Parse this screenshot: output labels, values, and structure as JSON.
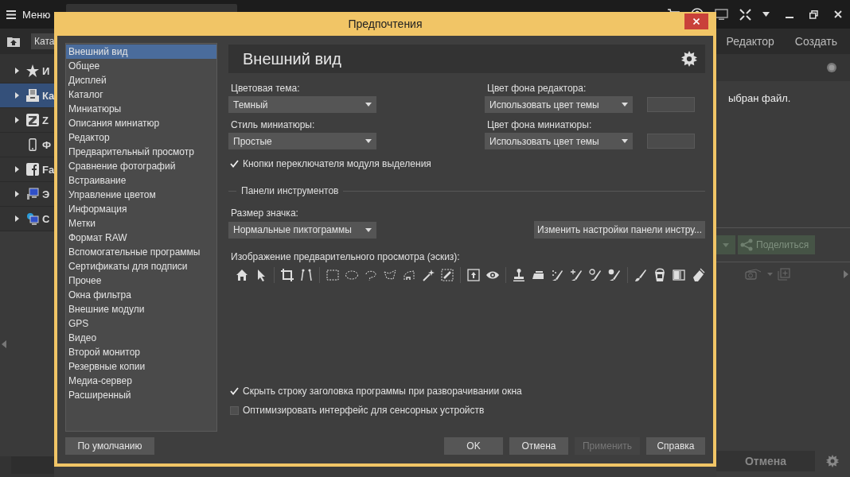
{
  "app": {
    "menu_label": "Меню",
    "breadcrumb": "Ката",
    "tabs": [
      {
        "label": "Редактор"
      },
      {
        "label": "Создать"
      }
    ],
    "nav_items": [
      {
        "label": "И",
        "kind": "star",
        "expandable": true,
        "selected": false
      },
      {
        "label": "Ка",
        "kind": "catalog",
        "expandable": true,
        "selected": true
      },
      {
        "label": "Z",
        "kind": "zletter",
        "expandable": true,
        "selected": false
      },
      {
        "label": "Ф",
        "kind": "phone",
        "expandable": false,
        "selected": false
      },
      {
        "label": "Fa",
        "kind": "facebook",
        "expandable": true,
        "selected": false
      },
      {
        "label": "Э",
        "kind": "computer",
        "expandable": true,
        "selected": false
      },
      {
        "label": "C",
        "kind": "network",
        "expandable": true,
        "selected": false
      }
    ],
    "info_text": "ыбран файл.",
    "share_button": "Поделиться",
    "cancel_button": "Отмена"
  },
  "dialog": {
    "title": "Предпочтения",
    "categories": [
      {
        "label": "Внешний вид",
        "selected": true
      },
      {
        "label": "Общее",
        "selected": false
      },
      {
        "label": "Дисплей",
        "selected": false
      },
      {
        "label": "Каталог",
        "selected": false
      },
      {
        "label": "Миниатюры",
        "selected": false
      },
      {
        "label": "Описания миниатюр",
        "selected": false
      },
      {
        "label": "Редактор",
        "selected": false
      },
      {
        "label": "Предварительный просмотр",
        "selected": false
      },
      {
        "label": "Сравнение фотографий",
        "selected": false
      },
      {
        "label": "Встраивание",
        "selected": false
      },
      {
        "label": "Управление цветом",
        "selected": false
      },
      {
        "label": "Информация",
        "selected": false
      },
      {
        "label": "Метки",
        "selected": false
      },
      {
        "label": "Формат RAW",
        "selected": false
      },
      {
        "label": "Вспомогательные программы",
        "selected": false
      },
      {
        "label": "Сертификаты для подписи",
        "selected": false
      },
      {
        "label": "Прочее",
        "selected": false
      },
      {
        "label": "Окна фильтра",
        "selected": false
      },
      {
        "label": "Внешние модули",
        "selected": false
      },
      {
        "label": "GPS",
        "selected": false
      },
      {
        "label": "Видео",
        "selected": false
      },
      {
        "label": "Второй монитор",
        "selected": false
      },
      {
        "label": "Резервные копии",
        "selected": false
      },
      {
        "label": "Медиа-сервер",
        "selected": false
      },
      {
        "label": "Расширенный",
        "selected": false
      }
    ],
    "section_title": "Внешний вид",
    "fields": [
      {
        "label": "Цветовая тема:",
        "value": "Темный",
        "swatch": false
      },
      {
        "label": "Цвет фона редактора:",
        "value": "Использовать цвет темы",
        "swatch": true
      },
      {
        "label": "Стиль миниатюры:",
        "value": "Простые",
        "swatch": false
      },
      {
        "label": "Цвет фона миниатюры:",
        "value": "Использовать цвет темы",
        "swatch": true
      }
    ],
    "selection_toggle": {
      "label": "Кнопки переключателя модуля выделения",
      "checked": true
    },
    "group_title": "Панели инструментов",
    "icon_size": {
      "label": "Размер значка:",
      "value": "Нормальные пиктограммы"
    },
    "customize_button": "Изменить настройки панели инстру...",
    "preview_label": "Изображение предварительного просмотра (эскиз):",
    "options": [
      {
        "label": "Скрыть строку заголовка программы при разворачивании окна",
        "checked": true
      },
      {
        "label": "Оптимизировать интерфейс для сенсорных устройств",
        "checked": false
      }
    ],
    "default_button": "По умолчанию",
    "buttons": [
      {
        "label": "OK",
        "disabled": false
      },
      {
        "label": "Отмена",
        "disabled": false
      },
      {
        "label": "Применить",
        "disabled": true
      },
      {
        "label": "Справка",
        "disabled": false
      }
    ]
  }
}
